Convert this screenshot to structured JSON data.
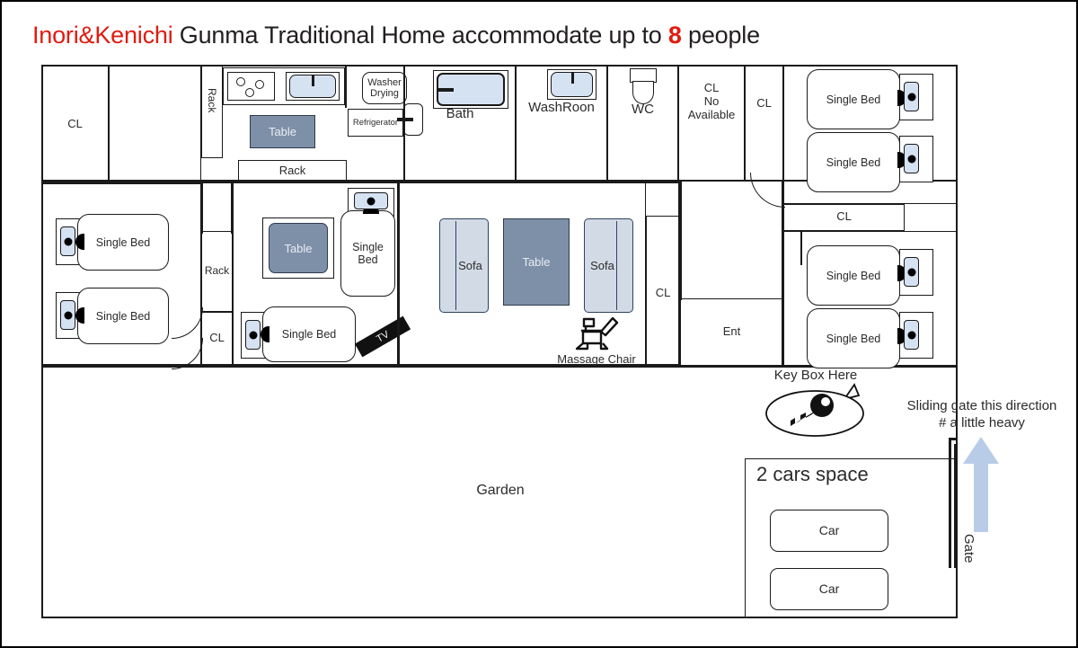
{
  "title": {
    "brand": "Inori&Kenichi",
    "text_before": " Gunma Traditional Home accommodate up to ",
    "count": "8",
    "text_after": " people"
  },
  "rooms": {
    "closet_top_left": "CL",
    "rack_vertical_kitchen": "Rack",
    "rack_horizontal": "Rack",
    "rack_vertical_hall": "Rack",
    "closet_hall": "CL",
    "washer_dryer": "Washer\nDrying",
    "refrigerator": "Refrigerator",
    "bath": "Bath",
    "washroom": "WashRoon",
    "wc": "WC",
    "closet_no_available": "CL\nNo\nAvailable",
    "closet_hallway": "CL",
    "closet_right_strip": "CL",
    "closet_living": "CL",
    "entrance": "Ent",
    "garden": "Garden"
  },
  "furniture": {
    "kitchen_table": "Table",
    "bedroom_table": "Table",
    "living_table": "Table",
    "sofa_left": "Sofa",
    "sofa_right": "Sofa",
    "massage_chair": "Massage Chair",
    "tv": "TV"
  },
  "beds": {
    "label": "Single\nBed",
    "count": 8,
    "list": [
      {
        "id": "bed-left-1",
        "label": "Single\nBed"
      },
      {
        "id": "bed-left-2",
        "label": "Single\nBed"
      },
      {
        "id": "bed-mid-1",
        "label": "Single\nBed"
      },
      {
        "id": "bed-mid-2",
        "label": "Single\nBed"
      },
      {
        "id": "bed-right-1",
        "label": "Single\nBed"
      },
      {
        "id": "bed-right-2",
        "label": "Single\nBed"
      },
      {
        "id": "bed-right-3",
        "label": "Single\nBed"
      },
      {
        "id": "bed-right-4",
        "label": "Single\nBed"
      }
    ]
  },
  "outside": {
    "key_box_label": "Key Box Here",
    "gate_note": "Sliding gate this direction\n# a little heavy",
    "gate_label": "Gate",
    "parking_title": "2 cars space",
    "car_1": "Car",
    "car_2": "Car"
  },
  "colors": {
    "accent_red": "#e01b10",
    "table_fill": "#7e8fa8",
    "sofa_fill": "#d2dae6",
    "water_fill": "#d5e2f2",
    "arrow_fill": "#b8cce8",
    "wall": "#1a1a1a"
  }
}
